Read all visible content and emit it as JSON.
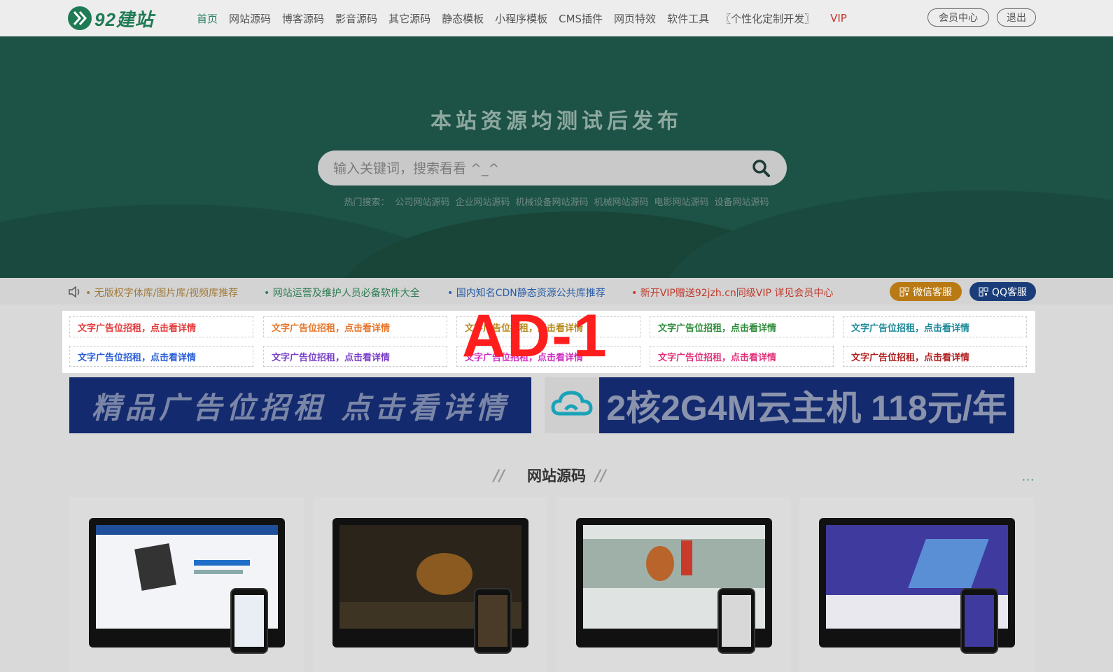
{
  "brand": {
    "logo_mark": "92",
    "logo_text": "92建站"
  },
  "nav": {
    "items": [
      {
        "label": "首页",
        "active": true
      },
      {
        "label": "网站源码"
      },
      {
        "label": "博客源码"
      },
      {
        "label": "影音源码"
      },
      {
        "label": "其它源码"
      },
      {
        "label": "静态模板"
      },
      {
        "label": "小程序模板"
      },
      {
        "label": "CMS插件"
      },
      {
        "label": "网页特效"
      },
      {
        "label": "软件工具"
      },
      {
        "label": "〖个性化定制开发〗"
      },
      {
        "label": "VIP"
      }
    ],
    "member_center": "会员中心",
    "logout": "退出"
  },
  "hero": {
    "title": "本站资源均测试后发布",
    "search_placeholder": "输入关键词，搜索看看 ^_^",
    "hot_label": "热门搜索：",
    "hot_terms": [
      "公司网站源码",
      "企业网站源码",
      "机械设备网站源码",
      "机械网站源码",
      "电影网站源码",
      "设备网站源码"
    ]
  },
  "notice": {
    "items": [
      {
        "text": "• 无版权字体库/图片库/视频库推荐",
        "color": "#a07a3a"
      },
      {
        "text": "• 网站运营及维护人员必备软件大全",
        "color": "#2e7d52"
      },
      {
        "text": "• 国内知名CDN静态资源公共库推荐",
        "color": "#2a5ea8"
      },
      {
        "text": "• 新开VIP赠送92jzh.cn同级VIP 详见会员中心",
        "color": "#c0392b"
      }
    ],
    "wechat_service": "微信客服",
    "qq_service": "QQ客服"
  },
  "ads": {
    "label": "AD-1",
    "row1": [
      {
        "text": "文字广告位招租，点击看详情",
        "color": "#e03c3c"
      },
      {
        "text": "文字广告位招租，点击看详情",
        "color": "#e6762a"
      },
      {
        "text": "文字广告位招租，点击看详情",
        "color": "#b88a1c"
      },
      {
        "text": "文字广告位招租，点击看详情",
        "color": "#2e8b3a"
      },
      {
        "text": "文字广告位招租，点击看详情",
        "color": "#1e8a9a"
      }
    ],
    "row2": [
      {
        "text": "文字广告位招租，点击看详情",
        "color": "#2a5ed6"
      },
      {
        "text": "文字广告位招租，点击看详情",
        "color": "#7a3fc8"
      },
      {
        "text": "文字广告位招租，点击看详情",
        "color": "#d02ec0"
      },
      {
        "text": "文字广告位招租，点击看详情",
        "color": "#e0307a"
      },
      {
        "text": "文字广告位招租，点击看详情",
        "color": "#b02020"
      }
    ]
  },
  "banners": {
    "left": "精品广告位招租 点击看详情",
    "right": "2核2G4M云主机 118元/年"
  },
  "section": {
    "title": "网站源码",
    "more": "···"
  },
  "colors": {
    "accent": "#1f7a55",
    "hero_bg": "#1d5246",
    "banner_bg": "#142a6e"
  }
}
